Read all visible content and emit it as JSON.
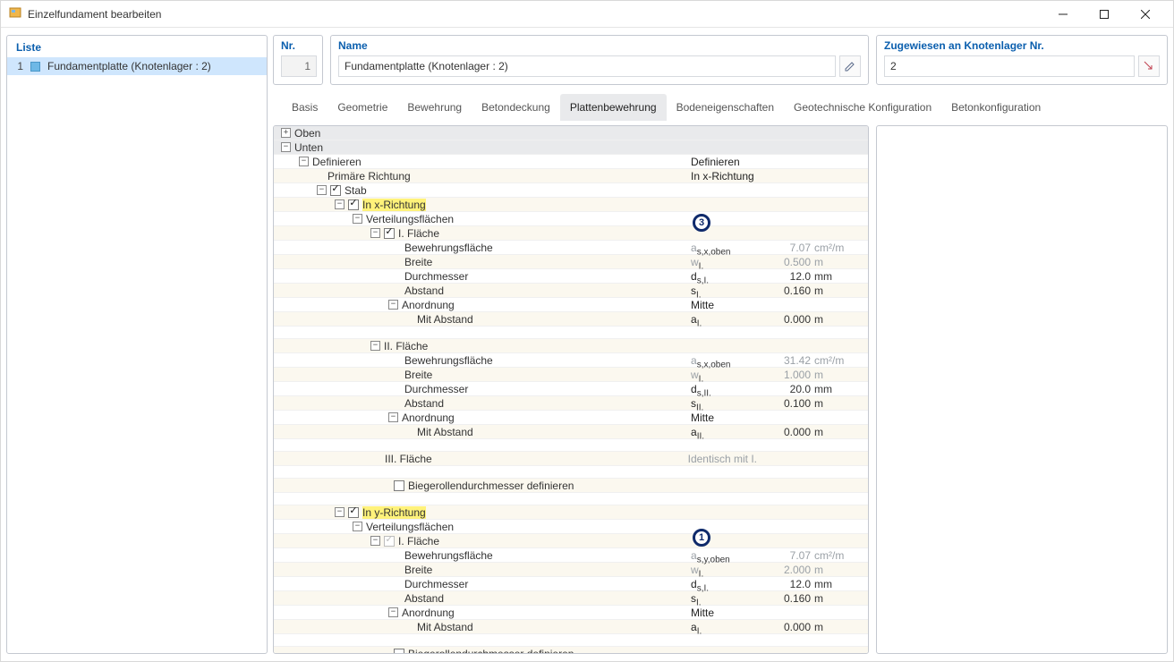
{
  "window_title": "Einzelfundament bearbeiten",
  "left_panel_title": "Liste",
  "list": {
    "num": "1",
    "label": "Fundamentplatte (Knotenlager : 2)"
  },
  "nr": {
    "title": "Nr.",
    "value": "1"
  },
  "name": {
    "title": "Name",
    "value": "Fundamentplatte (Knotenlager : 2)"
  },
  "assign": {
    "title": "Zugewiesen an Knotenlager Nr.",
    "value": "2"
  },
  "tabs": [
    "Basis",
    "Geometrie",
    "Bewehrung",
    "Betondeckung",
    "Plattenbewehrung",
    "Bodeneigenschaften",
    "Geotechnische Konfiguration",
    "Betonkonfiguration"
  ],
  "badge3": "3",
  "badge1": "1",
  "g_oben": "Oben",
  "g_unten": "Unten",
  "g_def": "Definieren",
  "g_def_val": "Definieren",
  "g_prim": "Primäre Richtung",
  "g_prim_val": "In x-Richtung",
  "g_stab": "Stab",
  "g_inx": "In x-Richtung",
  "g_vflx": "Verteilungsflächen",
  "g_f1": "I. Fläche",
  "r_bew": "Bewehrungsfläche",
  "r_bew_p": "as,x,oben",
  "r_bew_v": "7.07",
  "r_bew_u": "cm²/m",
  "r_br": "Breite",
  "r_br_p": "wI.",
  "r_br_v": "0.500",
  "r_br_u": "m",
  "r_du": "Durchmesser",
  "r_du_p": "ds,I.",
  "r_du_v": "12.0",
  "r_du_u": "mm",
  "r_ab": "Abstand",
  "r_ab_p": "sI.",
  "r_ab_v": "0.160",
  "r_ab_u": "m",
  "r_an": "Anordnung",
  "r_an_v": "Mitte",
  "r_ma": "Mit Abstand",
  "r_ma_p": "aI.",
  "r_ma_v": "0.000",
  "r_ma_u": "m",
  "g_f2": "II. Fläche",
  "r2_bew_v": "31.42",
  "r2_br_v": "1.000",
  "r2_du_p": "ds,II.",
  "r2_du_v": "20.0",
  "r2_ab_p": "sII.",
  "r2_ab_v": "0.100",
  "r2_ma_p": "aII.",
  "r2_ma_v": "0.000",
  "g_f3": "III. Fläche",
  "g_f3_v": "Identisch mit I.",
  "g_bieg": "Biegerollendurchmesser definieren",
  "g_iny": "In y-Richtung",
  "g_vfly": "Verteilungsflächen",
  "ry_bew_p": "as,y,oben",
  "ry_bew_v": "7.07",
  "ry_br_v": "2.000",
  "ry_du_v": "12.0",
  "ry_ab_v": "0.160",
  "ry_ma_v": "0.000"
}
